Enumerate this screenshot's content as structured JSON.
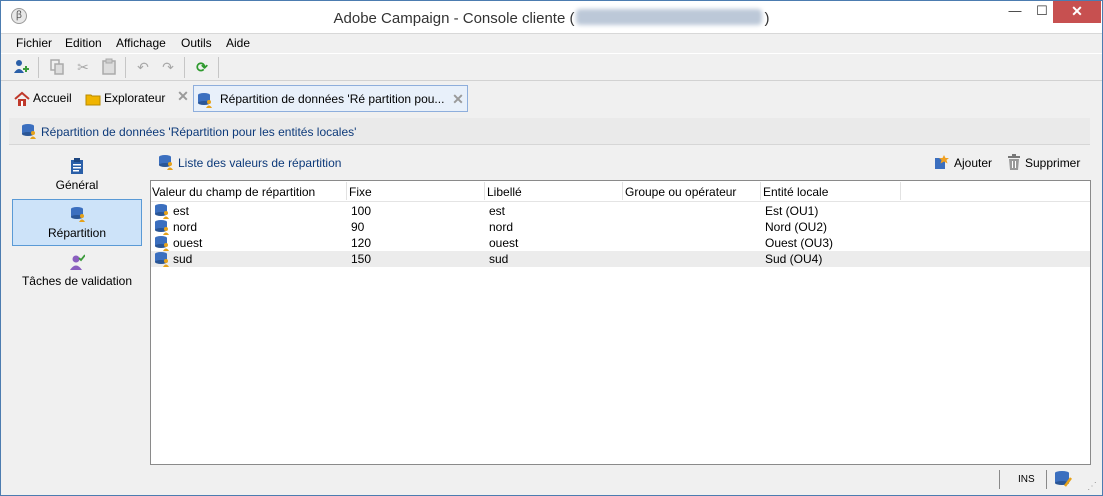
{
  "window": {
    "title_prefix": "Adobe Campaign - Console cliente (",
    "title_suffix": ")",
    "controls": {
      "minimize": "—",
      "maximize": "☐",
      "close": "✕"
    }
  },
  "menu": [
    "Fichier",
    "Edition",
    "Affichage",
    "Outils",
    "Aide"
  ],
  "toolbar": {
    "icons": [
      "new-user-icon",
      "copy-icon",
      "cut-icon",
      "paste-icon",
      "undo-icon",
      "redo-icon",
      "refresh-icon"
    ]
  },
  "tabs": [
    {
      "label": "Accueil",
      "icon": "home-icon"
    },
    {
      "label": "Explorateur",
      "icon": "folder-icon"
    },
    {
      "label": "Répartition de données 'Ré partition pou...",
      "icon": "database-user-icon",
      "active": true
    }
  ],
  "header": {
    "title": "Répartition de données 'Répartition pour les entités locales'"
  },
  "nav": [
    {
      "label": "Général",
      "icon": "clipboard-icon"
    },
    {
      "label": "Répartition",
      "icon": "database-user-icon",
      "selected": true
    },
    {
      "label": "Tâches de validation",
      "icon": "user-check-icon"
    }
  ],
  "panel": {
    "title": "Liste des valeurs de répartition",
    "add_label": "Ajouter",
    "delete_label": "Supprimer"
  },
  "grid": {
    "columns": [
      "Valeur du champ de répartition",
      "Fixe",
      "Libellé",
      "Groupe ou opérateur",
      "Entité locale"
    ],
    "rows": [
      {
        "value": "est",
        "fixed": "100",
        "label": "est",
        "group": "",
        "entity": "Est (OU1)"
      },
      {
        "value": "nord",
        "fixed": "90",
        "label": "nord",
        "group": "",
        "entity": "Nord (OU2)"
      },
      {
        "value": "ouest",
        "fixed": "120",
        "label": "ouest",
        "group": "",
        "entity": "Ouest (OU3)"
      },
      {
        "value": "sud",
        "fixed": "150",
        "label": "sud",
        "group": "",
        "entity": "Sud (OU4)"
      }
    ]
  },
  "status": {
    "ins": "INS"
  },
  "colors": {
    "accent": "#0d3a7a",
    "close": "#c75050",
    "selected_bg": "#cde3f9"
  }
}
